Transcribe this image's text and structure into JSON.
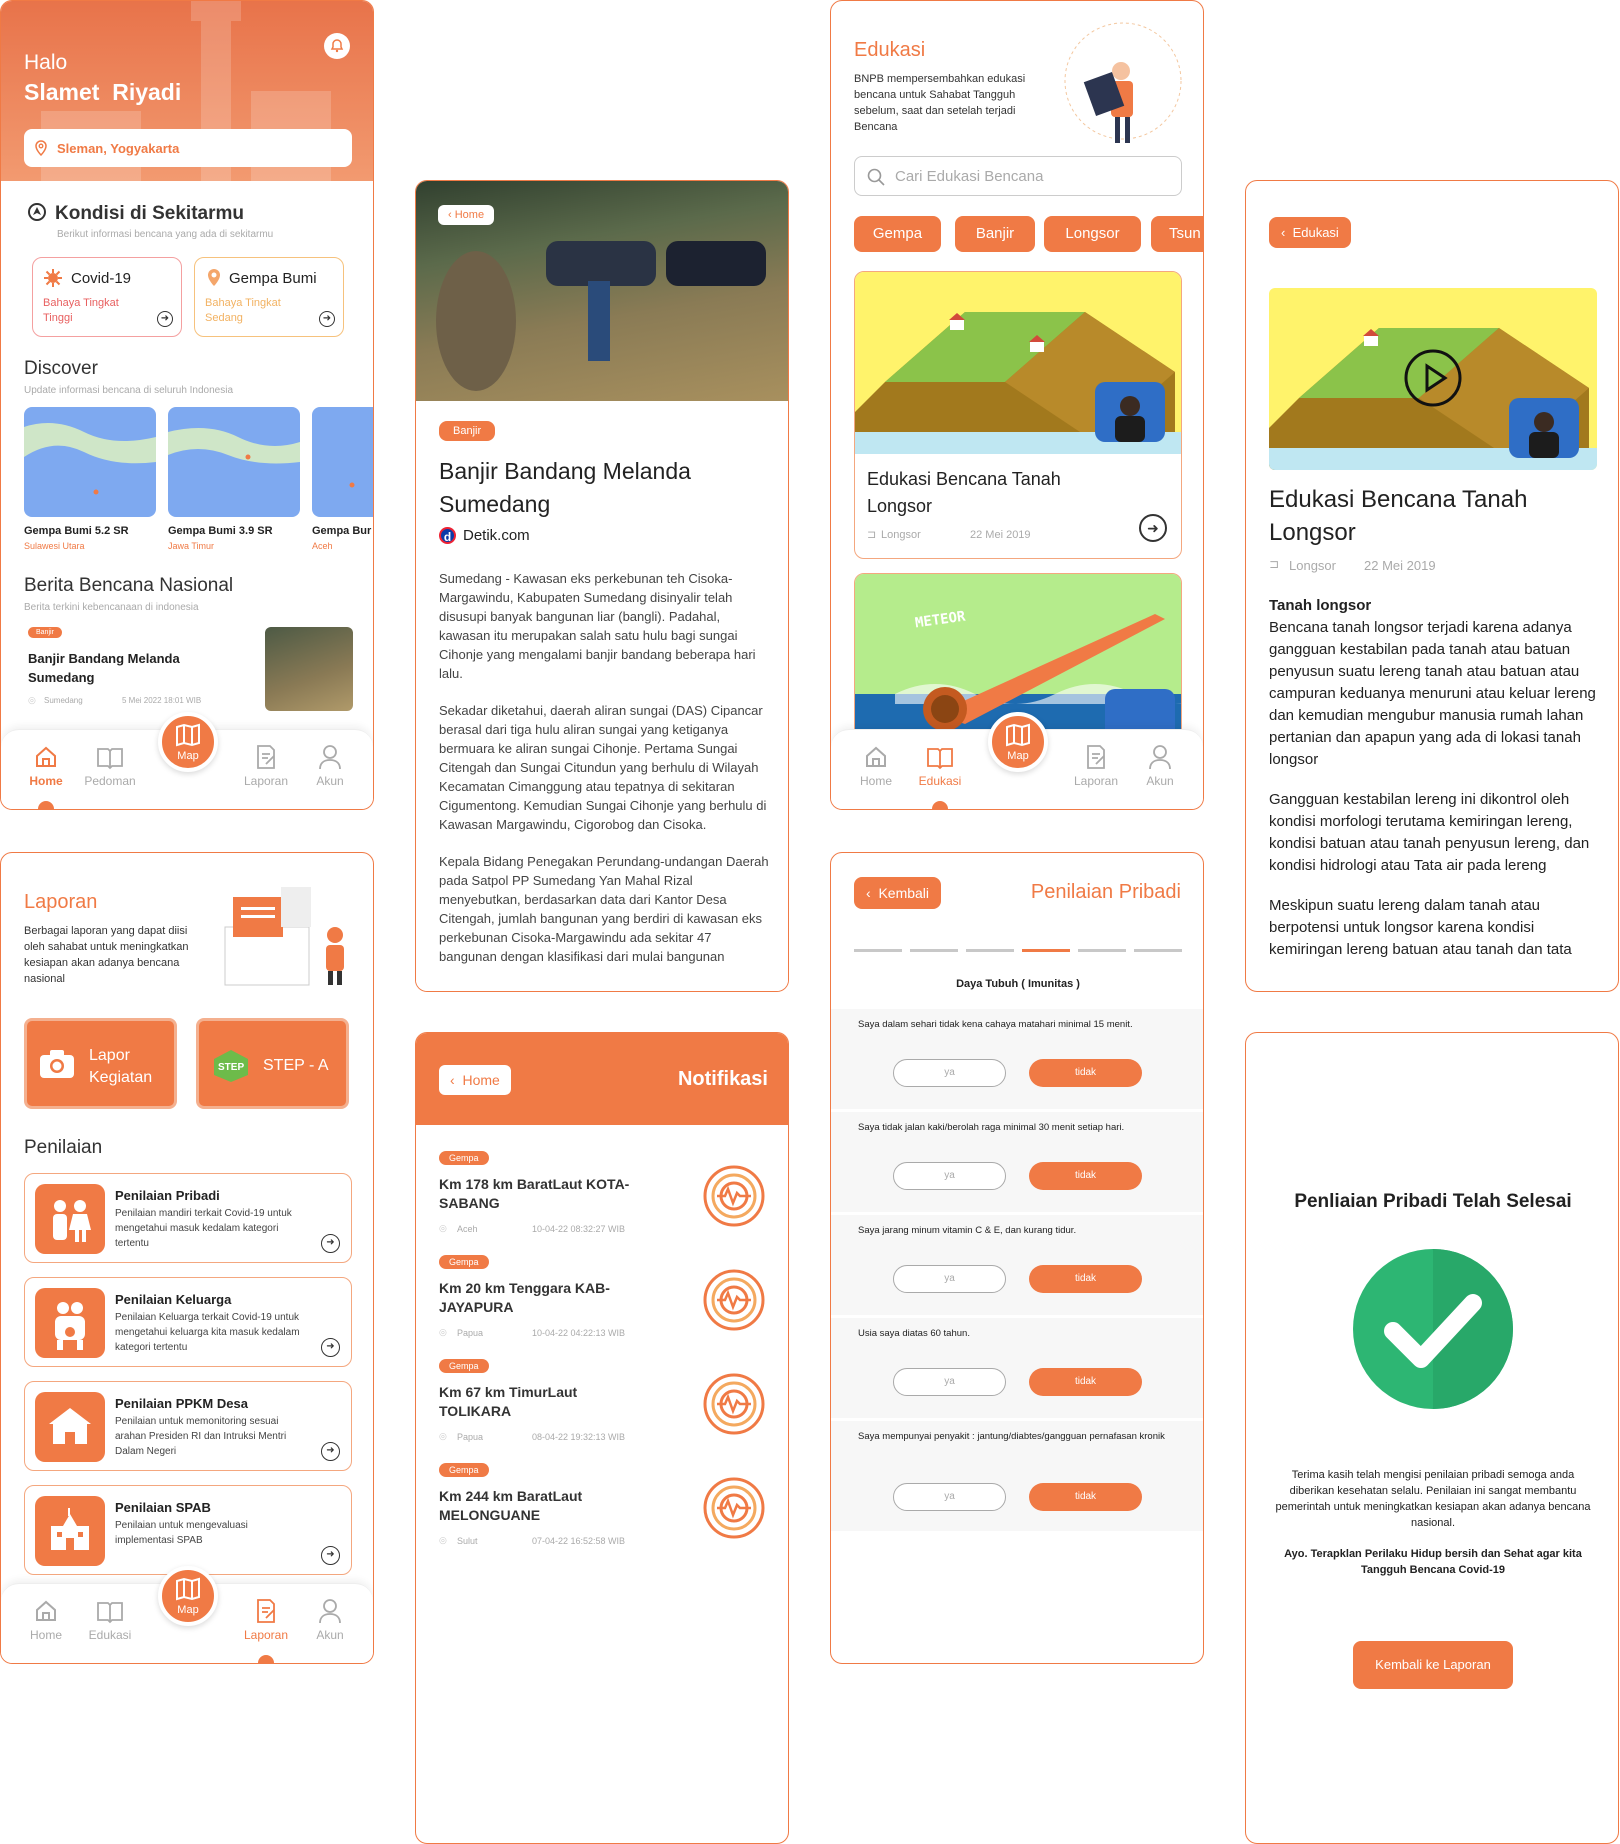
{
  "home": {
    "greet": "Halo",
    "name": "Slamet  Riyadi",
    "location": "Sleman, Yogyakarta",
    "kondisi_title": "Kondisi di Sekitarmu",
    "kondisi_sub": "Berikut informasi bencana yang ada di sekitarmu",
    "cards": [
      {
        "title": "Covid-19",
        "status": "Bahaya Tingkat Tinggi"
      },
      {
        "title": "Gempa Bumi",
        "status": "Bahaya Tingkat Sedang"
      }
    ],
    "discover_title": "Discover",
    "discover_sub": "Update informasi bencana di seluruh Indonesia",
    "maps": [
      {
        "title": "Gempa Bumi 5.2 SR",
        "loc": "Sulawesi Utara"
      },
      {
        "title": "Gempa Bumi 3.9 SR",
        "loc": "Jawa Timur"
      },
      {
        "title": "Gempa Bur",
        "loc": "Aceh"
      }
    ],
    "berita_title": "Berita Bencana Nasional",
    "berita_sub": "Berita terkini kebencanaan di indonesia",
    "news": {
      "chip": "Banjir",
      "title": "Banjir Bandang Melanda Sumedang",
      "loc": "Sumedang",
      "date": "5 Mei 2022 18:01 WIB"
    }
  },
  "nav": {
    "home": "Home",
    "pedoman": "Pedoman",
    "edukasi": "Edukasi",
    "map": "Map",
    "laporan": "Laporan",
    "akun": "Akun"
  },
  "article": {
    "back": "Home",
    "chip": "Banjir",
    "title": "Banjir Bandang Melanda Sumedang",
    "source": "Detik.com",
    "p1": "Sumedang - Kawasan eks perkebunan teh Cisoka-Margawindu, Kabupaten Sumedang disinyalir telah disusupi banyak bangunan liar (bangli). Padahal, kawasan itu merupakan salah satu hulu bagi sungai Cihonje yang mengalami banjir bandang beberapa hari lalu.",
    "p2": "Sekadar diketahui, daerah aliran sungai (DAS) Cipancar berasal dari tiga hulu aliran sungai yang ketiganya bermuara ke aliran sungai Cihonje. Pertama Sungai Citengah dan Sungai Citundun yang berhulu di Wilayah Kecamatan Cimanggung atau tepatnya di sekitaran Cigumentong. Kemudian Sungai Cihonje yang berhulu di Kawasan Margawindu, Cigorobog dan Cisoka.",
    "p3": "Kepala Bidang Penegakan Perundang-undangan Daerah pada Satpol PP Sumedang Yan Mahal Rizal menyebutkan, berdasarkan data dari Kantor Desa Citengah, jumlah bangunan yang berdiri di kawasan eks perkebunan Cisoka-Margawindu ada sekitar 47 bangunan dengan klasifikasi dari mulai bangunan"
  },
  "edukasi": {
    "title": "Edukasi",
    "desc": "BNPB mempersembahkan edukasi bencana untuk Sahabat Tangguh sebelum, saat dan setelah terjadi Bencana",
    "search_ph": "Cari Edukasi Bencana",
    "tabs": [
      "Gempa",
      "Banjir",
      "Longsor",
      "Tsun"
    ],
    "card1": {
      "title": "Edukasi Bencana Tanah Longsor",
      "tag": "Longsor",
      "date": "22 Mei 2019"
    },
    "meteor": "METEOR"
  },
  "detail": {
    "back": "Edukasi",
    "title": "Edukasi Bencana Tanah Longsor",
    "tag": "Longsor",
    "date": "22 Mei 2019",
    "h": "Tanah longsor",
    "p1": "Bencana tanah longsor terjadi karena adanya gangguan kestabilan pada tanah atau batuan penyusun suatu lereng tanah atau batuan atau campuran keduanya menuruni atau keluar lereng dan kemudian mengubur manusia rumah lahan pertanian dan apapun yang ada di lokasi tanah longsor",
    "p2": "Gangguan kestabilan lereng ini dikontrol oleh kondisi morfologi terutama kemiringan lereng, kondisi batuan atau tanah penyusun lereng, dan kondisi hidrologi atau Tata air pada lereng",
    "p3": "Meskipun suatu lereng dalam tanah atau berpotensi untuk longsor karena kondisi kemiringan lereng batuan atau tanah dan tata"
  },
  "laporan": {
    "title": "Laporan",
    "desc": "Berbagai laporan yang dapat diisi oleh sahabat untuk meningkatkan kesiapan akan adanya bencana nasional",
    "btn1": "Lapor Kegiatan",
    "btn2": "STEP - A",
    "penilaian": "Penilaian",
    "items": [
      {
        "title": "Penilaian Pribadi",
        "desc": "Penilaian mandiri terkait Covid-19 untuk mengetahui masuk kedalam kategori tertentu"
      },
      {
        "title": "Penilaian Keluarga",
        "desc": "Penilaian Keluarga terkait Covid-19 untuk mengetahui keluarga kita masuk kedalam kategori tertentu"
      },
      {
        "title": "Penilaian PPKM Desa",
        "desc": "Penilaian untuk memonitoring sesuai arahan Presiden RI dan Intruksi Mentri Dalam Negeri"
      },
      {
        "title": "Penilaian SPAB",
        "desc": "Penilaian untuk mengevaluasi implementasi SPAB"
      }
    ]
  },
  "notifikasi": {
    "back": "Home",
    "title": "Notifikasi",
    "items": [
      {
        "chip": "Gempa",
        "title": "Km 178 km BaratLaut KOTA-SABANG",
        "loc": "Aceh",
        "date": "10-04-22 08:32:27 WIB"
      },
      {
        "chip": "Gempa",
        "title": "Km 20 km Tenggara KAB-JAYAPURA",
        "loc": "Papua",
        "date": "10-04-22 04:22:13 WIB"
      },
      {
        "chip": "Gempa",
        "title": "Km 67 km TimurLaut TOLIKARA",
        "loc": "Papua",
        "date": "08-04-22 19:32:13 WIB"
      },
      {
        "chip": "Gempa",
        "title": "Km 244 km BaratLaut MELONGUANE",
        "loc": "Sulut",
        "date": "07-04-22 16:52:58 WIB"
      }
    ]
  },
  "penilaian": {
    "back": "Kembali",
    "title": "Penilaian Pribadi",
    "section": "Daya Tubuh ( Imunitas )",
    "ya": "ya",
    "tidak": "tidak",
    "questions": [
      "Saya dalam sehari tidak kena cahaya matahari minimal 15 menit.",
      "Saya tidak jalan kaki/berolah raga minimal 30 menit setiap hari.",
      "Saya jarang minum vitamin C & E, dan kurang tidur.",
      "Usia saya diatas 60 tahun.",
      "Saya mempunyai penyakit : jantung/diabtes/gangguan pernafasan kronik"
    ]
  },
  "selesai": {
    "title": "Penliaian Pribadi Telah Selesai",
    "p1": "Terima kasih telah mengisi penilaian pribadi semoga anda diberikan kesehatan selalu. Penilaian ini sangat membantu pemerintah untuk meningkatkan kesiapan akan adanya bencana nasional.",
    "p2": "Ayo. Terapklan Perilaku Hidup bersih dan Sehat agar kita Tangguh Bencana Covid-19",
    "btn": "Kembali ke Laporan"
  },
  "colors": {
    "accent": "#f07a45",
    "green": "#2db673"
  }
}
